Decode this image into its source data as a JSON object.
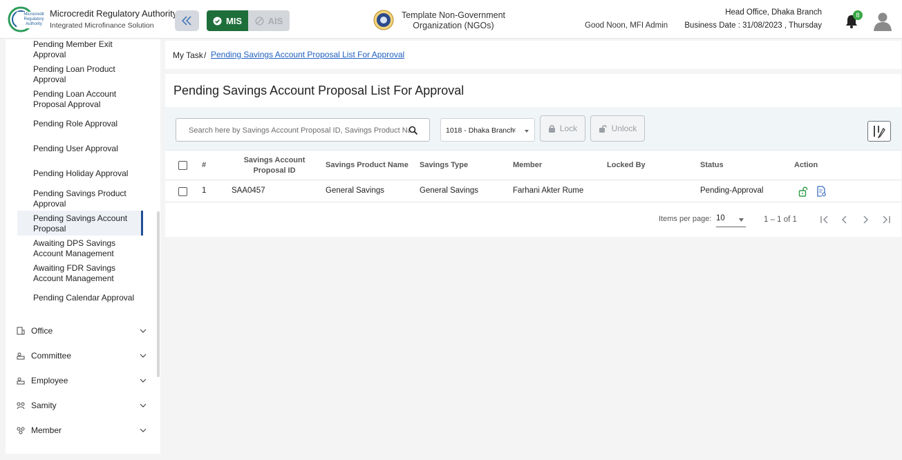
{
  "header": {
    "brand_title": "Microcredit Regulatory Authority",
    "brand_subtitle": "Integrated Microfinance Solution",
    "logo_text": "Microcredit Regulatory Authority",
    "mis_label": "MIS",
    "ais_label": "AIS",
    "org_name": "Template Non-Government Organization (NGOs)",
    "greeting": "Good Noon, MFI Admin",
    "office": "Head Office, Dhaka Branch",
    "business_date": "Business Date : 31/08/2023 , Thursday",
    "notification_count": "8",
    "colors": {
      "mis_active": "#1e6e3a",
      "accent_link": "#1f5fbf",
      "active_menu_bar": "#1f4e96",
      "badge": "#39a845"
    }
  },
  "sidebar": {
    "items": [
      {
        "label": "Pending Member Exit Approval"
      },
      {
        "label": "Pending Loan Product Approval"
      },
      {
        "label": "Pending Loan Account Proposal Approval"
      },
      {
        "label": "Pending Role Approval"
      },
      {
        "label": "Pending User Approval"
      },
      {
        "label": "Pending Holiday Approval"
      },
      {
        "label": "Pending Savings Product Approval"
      },
      {
        "label": "Pending Savings Account Proposal",
        "active": true
      },
      {
        "label": "Awaiting DPS Savings Account Management"
      },
      {
        "label": "Awaiting FDR Savings Account Management"
      },
      {
        "label": "Pending Calendar Approval"
      }
    ],
    "groups": [
      {
        "label": "Office",
        "icon": "office-icon"
      },
      {
        "label": "Committee",
        "icon": "committee-icon"
      },
      {
        "label": "Employee",
        "icon": "employee-icon"
      },
      {
        "label": "Samity",
        "icon": "samity-icon"
      },
      {
        "label": "Member",
        "icon": "member-icon"
      }
    ]
  },
  "breadcrumb": {
    "home": "My Task",
    "separator": "/",
    "current": "Pending Savings Account Proposal List For Approval"
  },
  "page": {
    "title": "Pending Savings Account Proposal List For Approval"
  },
  "toolbar": {
    "search_placeholder": "Search here by Savings Account Proposal ID, Savings Product Name",
    "branch_value": "1018 - Dhaka Branch",
    "branch_clear": "×",
    "lock_label": "Lock",
    "unlock_label": "Unlock"
  },
  "table": {
    "columns": {
      "index": "#",
      "proposal_id": "Savings Account Proposal ID",
      "product_name": "Savings Product Name",
      "savings_type": "Savings Type",
      "member": "Member",
      "locked_by": "Locked By",
      "status": "Status",
      "action": "Action"
    },
    "rows": [
      {
        "index": "1",
        "proposal_id": "SAA0457",
        "product_name": "General Savings",
        "savings_type": "General Savings",
        "member": "Farhani Akter Rume",
        "locked_by": "",
        "status": "Pending-Approval"
      }
    ]
  },
  "paginator": {
    "items_per_page_label": "Items per page:",
    "items_per_page": "10",
    "range": "1 – 1 of 1"
  }
}
